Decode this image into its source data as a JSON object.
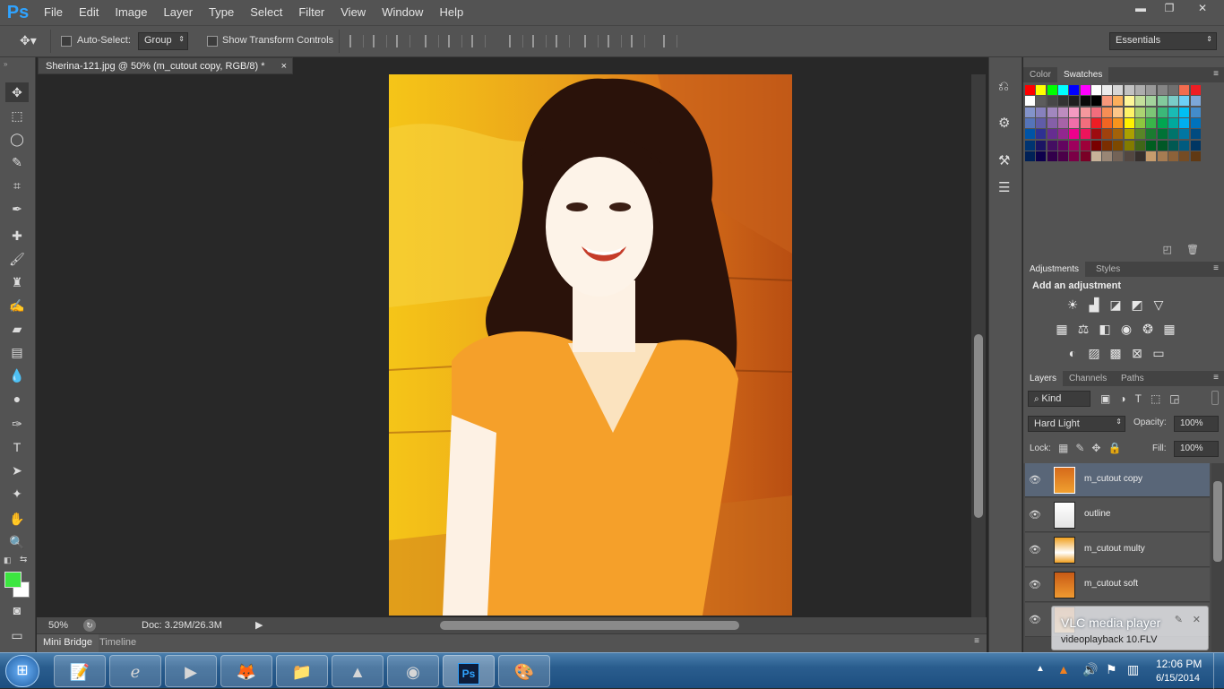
{
  "menubar": {
    "app_logo": "Ps",
    "items": [
      "File",
      "Edit",
      "Image",
      "Layer",
      "Type",
      "Select",
      "Filter",
      "View",
      "Window",
      "Help"
    ],
    "win_minimize": "▬",
    "win_restore": "❐",
    "win_close": "✕"
  },
  "options": {
    "auto_select_label": "Auto-Select:",
    "auto_select_mode": "Group",
    "show_transform_label": "Show Transform Controls",
    "workspace": "Essentials"
  },
  "document": {
    "tab_title": "Sherina-121.jpg @ 50% (m_cutout copy, RGB/8) *",
    "close": "×",
    "zoom": "50%",
    "doc_info": "Doc: 3.29M/26.3M"
  },
  "bottom_tabs": [
    "Mini Bridge",
    "Timeline"
  ],
  "color_panel": {
    "tabs": [
      "Color",
      "Swatches"
    ]
  },
  "swatches": [
    "#ff0000",
    "#ffff00",
    "#00ff00",
    "#00ffff",
    "#0000ff",
    "#ff00ff",
    "#ffffff",
    "#ebebeb",
    "#d6d6d6",
    "#c2c2c2",
    "#adadad",
    "#999999",
    "#858585",
    "#707070",
    "#f26c4f",
    "#ee1d24",
    "#ffffff",
    "#5c5c5c",
    "#474747",
    "#333333",
    "#1f1f1f",
    "#0a0a0a",
    "#000000",
    "#f7977a",
    "#fbaf5c",
    "#fff799",
    "#c4df9b",
    "#a3d39c",
    "#82ca9c",
    "#7accc8",
    "#6dcff6",
    "#7da7d9",
    "#8393ca",
    "#8781bd",
    "#a187be",
    "#bd8cbf",
    "#f49ac1",
    "#f5989d",
    "#f26d7d",
    "#f68e55",
    "#fdc689",
    "#fff467",
    "#acd372",
    "#7cc576",
    "#3bb878",
    "#1abbb4",
    "#00bff3",
    "#438ccb",
    "#5574b9",
    "#605ca8",
    "#855fa8",
    "#a763a8",
    "#f06ea9",
    "#f26d7d",
    "#ed1c24",
    "#f26522",
    "#f7941d",
    "#fff200",
    "#8dc63f",
    "#39b54a",
    "#00a651",
    "#00a99d",
    "#00aeef",
    "#0072bc",
    "#0054a6",
    "#2e3192",
    "#662d91",
    "#92278f",
    "#ec008c",
    "#ed145b",
    "#9e0b0f",
    "#a0410d",
    "#a36209",
    "#aba000",
    "#598527",
    "#1a7b30",
    "#007236",
    "#00746b",
    "#0076a3",
    "#004b80",
    "#003471",
    "#1b1464",
    "#440e62",
    "#630460",
    "#9e005d",
    "#9e0039",
    "#790000",
    "#7b2e00",
    "#7d4900",
    "#827b00",
    "#406618",
    "#005e20",
    "#005826",
    "#005952",
    "#005b7f",
    "#003663",
    "#002157",
    "#0d004c",
    "#32004b",
    "#4b0049",
    "#7b0046",
    "#7a0026",
    "#c7b299",
    "#998675",
    "#736357",
    "#534741",
    "#37302d",
    "#c69c6d",
    "#a67c52",
    "#8c6239",
    "#754c24",
    "#603913"
  ],
  "adjustments": {
    "tabs": [
      "Adjustments",
      "Styles"
    ],
    "heading": "Add an adjustment",
    "icons": [
      [
        "brightness-icon",
        "levels-icon",
        "curves-icon",
        "exposure-icon",
        "gradient-triangle-icon"
      ],
      [
        "vibrance-icon",
        "balance-icon",
        "bw-icon",
        "photo-filter-icon",
        "channel-mixer-icon",
        "color-lookup-icon"
      ],
      [
        "invert-icon",
        "posterize-icon",
        "threshold-icon",
        "selective-color-icon",
        "gradient-map-icon"
      ]
    ]
  },
  "layers_panel": {
    "tabs": [
      "Layers",
      "Channels",
      "Paths"
    ],
    "kind": "Kind",
    "blend_mode": "Hard Light",
    "opacity_label": "Opacity:",
    "opacity": "100%",
    "lock_label": "Lock:",
    "fill_label": "Fill:",
    "fill": "100%",
    "layers": [
      {
        "name": "m_cutout copy",
        "selected": true
      },
      {
        "name": "outline",
        "selected": false
      },
      {
        "name": "m_cutout multy",
        "selected": false
      },
      {
        "name": "m_cutout soft",
        "selected": false
      },
      {
        "name": "",
        "selected": false
      }
    ]
  },
  "vlc_popup": {
    "title": "VLC media player",
    "subtitle": "videoplayback 10.FLV"
  },
  "taskbar": {
    "time": "12:06 PM",
    "date": "6/15/2014"
  }
}
